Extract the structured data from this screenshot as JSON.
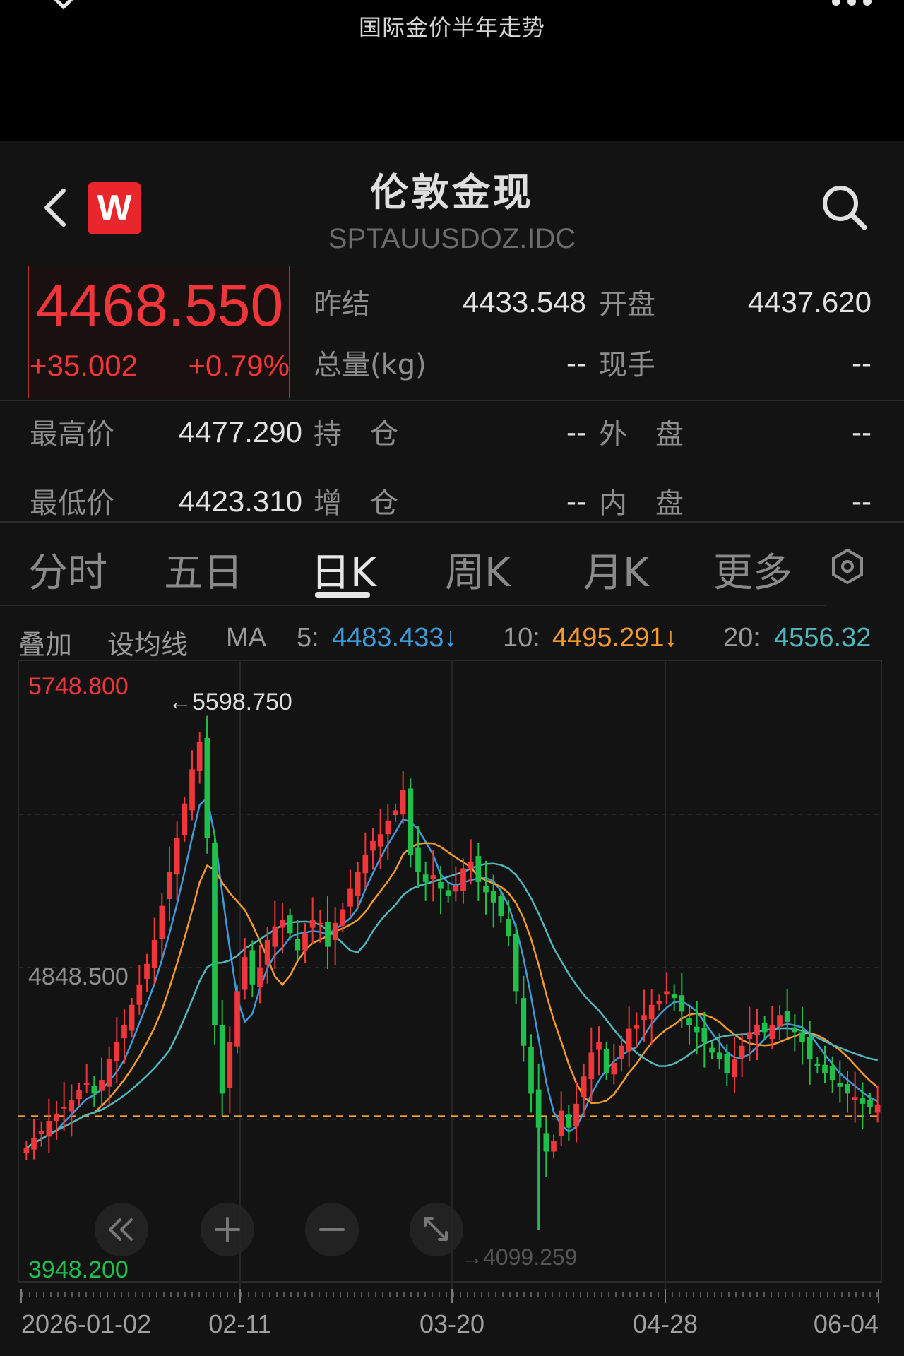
{
  "header": {
    "caption": "国际金价半年走势"
  },
  "instrument": {
    "name": "伦敦金现",
    "code": "SPTAUUSDOZ.IDC",
    "logo": "W"
  },
  "quote": {
    "last": "4468.550",
    "change": "+35.002",
    "change_pct": "+0.79%",
    "stats": {
      "prev_close_label": "昨结",
      "prev_close": "4433.548",
      "open_label": "开盘",
      "open": "4437.620",
      "volume_label": "总量(kg)",
      "volume": "--",
      "current_hand_label": "现手",
      "current_hand": "--",
      "high_label": "最高价",
      "high": "4477.290",
      "open_interest_label": "持　仓",
      "open_interest": "--",
      "outer_label": "外　盘",
      "outer": "--",
      "low_label": "最低价",
      "low": "4423.310",
      "oi_change_label": "增　仓",
      "oi_change": "--",
      "inner_label": "内　盘",
      "inner": "--"
    }
  },
  "tabs": [
    "分时",
    "五日",
    "日K",
    "周K",
    "月K",
    "更多"
  ],
  "active_tab": "日K",
  "ma_bar": {
    "overlay": "叠加",
    "set_ma": "设均线",
    "ma": "MA",
    "ma5_label": "5:",
    "ma5": "4483.433↓",
    "ma10_label": "10:",
    "ma10": "4495.291↓",
    "ma20_label": "20:",
    "ma20": "4556.32"
  },
  "colors": {
    "up": "#f0363a",
    "down": "#1fbf4a",
    "ma5": "#3f9bd8",
    "ma10": "#f29a2e",
    "ma20": "#4fb7bd"
  },
  "chart_data": {
    "type": "candlestick",
    "ylim": [
      3948.2,
      5748.8
    ],
    "y_ticks": [
      "5748.800",
      "4848.500",
      "3948.200"
    ],
    "x_ticks": [
      "2026-01-02",
      "02-11",
      "03-20",
      "04-28",
      "06-04"
    ],
    "high_marker": "5598.750",
    "low_marker": "4099.259",
    "reference_line": 4433.548,
    "series_close": [
      4340,
      4370,
      4390,
      4420,
      4440,
      4460,
      4480,
      4510,
      4530,
      4500,
      4540,
      4600,
      4650,
      4700,
      4760,
      4820,
      4880,
      4950,
      5050,
      5150,
      5250,
      5350,
      5450,
      5530,
      5250,
      4700,
      4500,
      4650,
      4800,
      4900,
      4820,
      4870,
      4950,
      4990,
      5010,
      4970,
      4920,
      4970,
      5010,
      5000,
      4930,
      5000,
      5040,
      5100,
      5150,
      5200,
      5240,
      5260,
      5300,
      5330,
      5390,
      5200,
      5150,
      5120,
      5140,
      5100,
      5080,
      5110,
      5160,
      5180,
      5120,
      5090,
      5060,
      5020,
      4960,
      4800,
      4640,
      4500,
      4400,
      4330,
      4360,
      4450,
      4400,
      4470,
      4550,
      4620,
      4650,
      4560,
      4590,
      4640,
      4690,
      4700,
      4730,
      4760,
      4770,
      4800,
      4780,
      4740,
      4700,
      4680,
      4650,
      4620,
      4600,
      4560,
      4600,
      4640,
      4680,
      4700,
      4680,
      4700,
      4730,
      4710,
      4680,
      4650,
      4600,
      4580,
      4560,
      4540,
      4520,
      4500,
      4490,
      4470,
      4460,
      4468
    ]
  }
}
